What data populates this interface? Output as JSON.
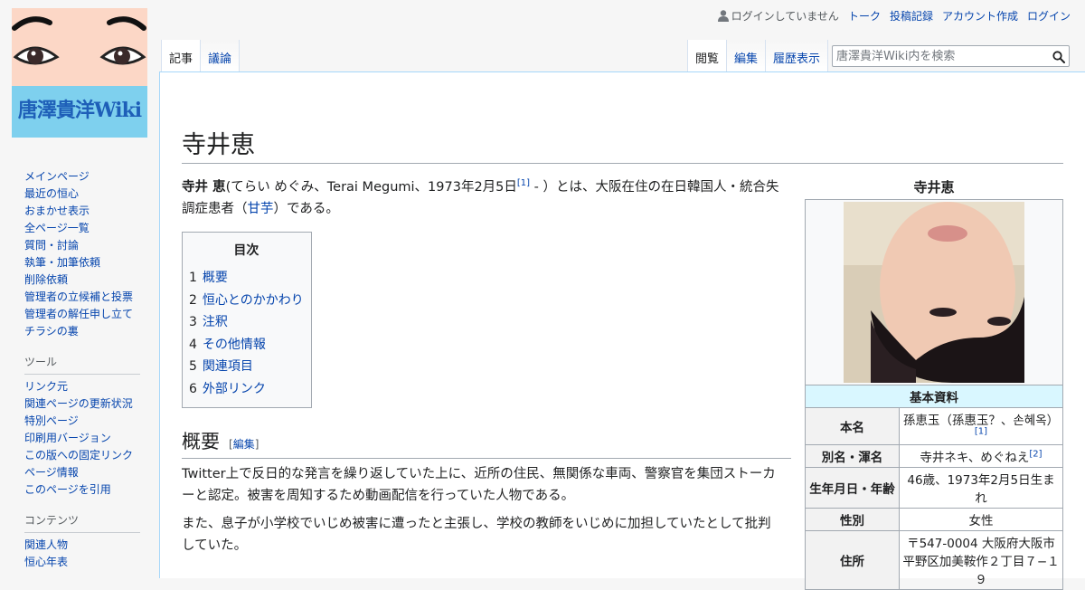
{
  "logo": {
    "text": "唐澤貴洋Wiki"
  },
  "personal": {
    "anon": "ログインしていません",
    "items": [
      "トーク",
      "投稿記録",
      "アカウント作成",
      "ログイン"
    ]
  },
  "tabs_left": [
    "記事",
    "議論"
  ],
  "tabs_right": [
    "閲覧",
    "編集",
    "履歴表示"
  ],
  "search": {
    "placeholder": "唐澤貴洋Wiki内を検索"
  },
  "sidebar": {
    "nav": [
      "メインページ",
      "最近の恒心",
      "おまかせ表示",
      "全ページ一覧",
      "質問・討論",
      "執筆・加筆依頼",
      "削除依頼",
      "管理者の立候補と投票",
      "管理者の解任申し立て",
      "チラシの裏"
    ],
    "tools_heading": "ツール",
    "tools": [
      "リンク元",
      "関連ページの更新状況",
      "特別ページ",
      "印刷用バージョン",
      "この版への固定リンク",
      "ページ情報",
      "このページを引用"
    ],
    "contents_heading": "コンテンツ",
    "contents": [
      "関連人物",
      "恒心年表"
    ]
  },
  "article": {
    "title": "寺井恵",
    "intro": {
      "bold": "寺井 恵",
      "part1": "(てらい めぐみ、Terai Megumi、1973年2月5日",
      "ref1": "[1]",
      "part2": " - ）とは、大阪在住の在日韓国人・統合失調症患者（",
      "link": "甘芋",
      "part3": "）である。"
    },
    "toc": {
      "title": "目次",
      "items": [
        {
          "num": "1",
          "label": "概要"
        },
        {
          "num": "2",
          "label": "恒心とのかかわり"
        },
        {
          "num": "3",
          "label": "注釈"
        },
        {
          "num": "4",
          "label": "その他情報"
        },
        {
          "num": "5",
          "label": "関連項目"
        },
        {
          "num": "6",
          "label": "外部リンク"
        }
      ]
    },
    "section1": {
      "heading": "概要",
      "edit_open": "[",
      "edit": "編集",
      "edit_close": "]",
      "p1": "Twitter上で反日的な発言を繰り返していた上に、近所の住民、無関係な車両、警察官を集団ストーカーと認定。被害を周知するため動画配信を行っていた人物である。",
      "p2": "また、息子が小学校でいじめ被害に遭ったと主張し、学校の教師をいじめに加担していたとして批判していた。"
    }
  },
  "infobox": {
    "title": "寺井恵",
    "section": "基本資料",
    "rows": [
      {
        "label": "本名",
        "value": "孫恵玉（孫惠玉？、손혜옥）",
        "ref": "[1]"
      },
      {
        "label": "別名・渾名",
        "value": "寺井ネキ、めぐねえ",
        "ref": "[2]"
      },
      {
        "label": "生年月日・年齢",
        "value": "46歳、1973年2月5日生まれ",
        "ref": ""
      },
      {
        "label": "性別",
        "value": "女性",
        "ref": ""
      },
      {
        "label": "住所",
        "value": "〒547-0004 大阪府大阪市平野区加美鞍作２丁目７−１９",
        "ref": ""
      }
    ]
  },
  "colors": {
    "link": "#0645ad",
    "infobox_section": "#d9f7ff",
    "border": "#a2a9b1"
  }
}
